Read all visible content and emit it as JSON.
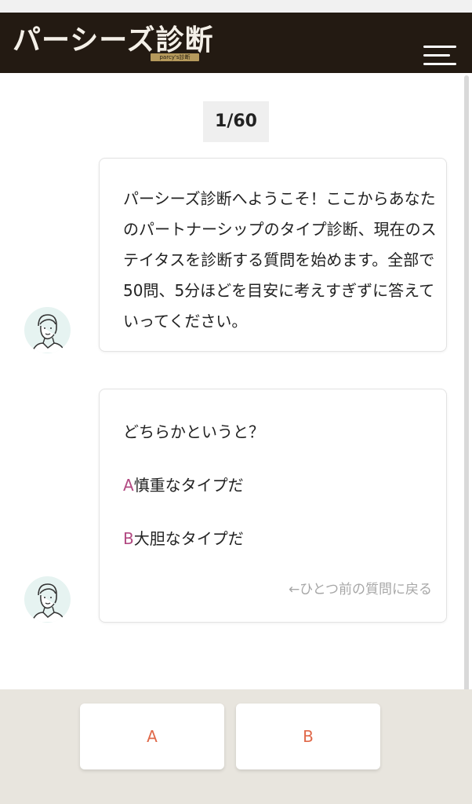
{
  "header": {
    "logo_title": "パーシーズ診断",
    "logo_subtitle": "parcy's診断",
    "menu_icon": "hamburger-menu-icon"
  },
  "progress": {
    "label": "1/60",
    "current": 1,
    "total": 60
  },
  "messages": {
    "intro": "パーシーズ診断へようこそ！ここからあなたのパートナーシップのタイプ診断、現在のステイタスを診断する質問を始めます。全部で50問、5分ほどを目安に考えすぎずに答えていってください。",
    "question": {
      "prompt": "どちらかというと？",
      "option_a_letter": "A",
      "option_a_text": "慎重なタイプだ",
      "option_b_letter": "B",
      "option_b_text": "大胆なタイプだ",
      "back_link": "←ひとつ前の質問に戻る"
    }
  },
  "answers": {
    "a_label": "A",
    "b_label": "B"
  },
  "colors": {
    "header_bg": "#231a12",
    "option_letter": "#b24a82",
    "answer_text": "#e0694a",
    "bottom_bar_bg": "#e8e5de",
    "avatar_bg": "#e6f3f1"
  }
}
